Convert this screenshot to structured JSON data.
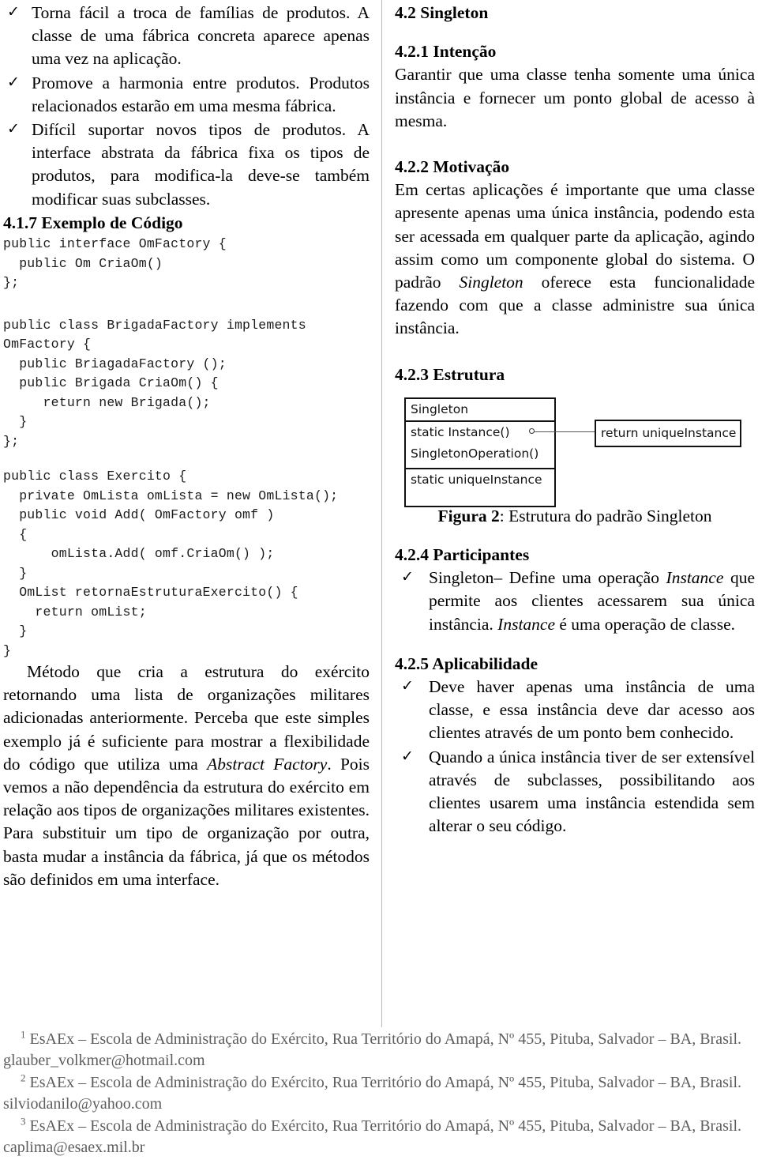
{
  "document": {
    "left_column": {
      "consequences_bullets": [
        "Torna fácil a troca de famílias de produtos. A classe de uma fábrica concreta aparece apenas uma vez na aplicação.",
        "Promove a harmonia entre produtos. Produtos relacionados estarão em uma mesma fábrica.",
        "Difícil suportar novos tipos de produtos. A interface abstrata da fábrica fixa os tipos de produtos, para modifica-la deve-se também modificar suas subclasses."
      ],
      "section_code": {
        "number_title": "4.1.7 Exemplo de Código",
        "block_1": "public interface OmFactory {\n  public Om CriaOm()\n};",
        "block_2": "public class BrigadaFactory implements\nOmFactory {\n  public BriagadaFactory ();\n  public Brigada CriaOm() {\n     return new Brigada();\n  }\n};",
        "block_3": "public class Exercito {\n  private OmLista omLista = new OmLista();\n  public void Add( OmFactory omf )\n  {\n      omLista.Add( omf.CriaOm() );\n  }\n  OmList retornaEstruturaExercito() {\n    return omList;\n  }\n}"
      },
      "closing_paragraph": {
        "part_1": "Método que cria a estrutura do exército retornando uma lista de organizações militares adicionadas anteriormente. Perceba que este simples exemplo já é suficiente para mostrar a flexibilidade do código que utiliza uma ",
        "italic_1": "Abstract Factory",
        "part_2": ". Pois vemos a não dependência da estrutura do exército em relação aos tipos de organizações militares existentes. Para substituir um tipo de organização por outra, basta mudar a instância da fábrica, já que os métodos são definidos em uma interface."
      }
    },
    "right_column": {
      "section_singleton": "4.2 Singleton",
      "section_intencao": {
        "heading": "4.2.1 Intenção",
        "text": "Garantir que uma classe tenha somente uma única instância e fornecer um ponto global de acesso à mesma."
      },
      "section_motivacao": {
        "heading": "4.2.2 Motivação",
        "part_1": "Em certas aplicações é importante que uma classe apresente apenas uma única instância, podendo esta ser acessada em qualquer parte da aplicação, agindo assim como um componente global do sistema. O padrão ",
        "italic_1": "Singleton",
        "part_2": " oferece esta funcionalidade fazendo com que a classe administre sua única instância."
      },
      "section_estrutura": {
        "heading": "4.2.3 Estrutura",
        "figure": {
          "class_name": "Singleton",
          "operations": [
            "static Instance()",
            "SingletonOperation()"
          ],
          "attributes": [
            "static uniqueInstance"
          ],
          "note": "return uniqueInstance",
          "caption_label": "Figura 2",
          "caption_text": ": Estrutura do padrão Singleton"
        }
      },
      "section_participantes": {
        "heading": "4.2.4 Participantes",
        "bullet": {
          "part_1": "Singleton– Define uma operação ",
          "italic_1": "Instance",
          "part_2": " que permite aos clientes acessarem sua única instância. ",
          "italic_2": "Instance",
          "part_3": " é uma operação de classe."
        }
      },
      "section_aplicabilidade": {
        "heading": "4.2.5 Aplicabilidade",
        "bullets": [
          "Deve haver apenas uma instância de uma classe, e essa instância deve dar acesso aos clientes através de um ponto bem conhecido.",
          "Quando a única instância tiver de ser extensível através de subclasses, possibilitando aos clientes usarem uma instância estendida sem alterar o seu código."
        ]
      }
    },
    "footnotes": [
      {
        "marker": "1",
        "line_1": "EsAEx – Escola de Administração do Exército, Rua Território do Amapá, Nº 455, Pituba,",
        "line_2": "Salvador – BA, Brasil. glauber_volkmer@hotmail.com"
      },
      {
        "marker": "2",
        "line_1": "EsAEx – Escola de Administração do Exército, Rua Território do Amapá, Nº 455, Pituba,",
        "line_2": "Salvador – BA, Brasil. silviodanilo@yahoo.com"
      },
      {
        "marker": "3",
        "line_1": "EsAEx – Escola de Administração do Exército, Rua Território do Amapá, Nº 455, Pituba,",
        "line_2": "Salvador – BA, Brasil. caplima@esaex.mil.br"
      }
    ],
    "icons": {
      "check_bullet": "✓"
    },
    "colors": {
      "text": "#000000",
      "footnote_text": "#5d5d5d",
      "rule": "#b9b9b9",
      "diagram_stroke": "#111111"
    }
  }
}
